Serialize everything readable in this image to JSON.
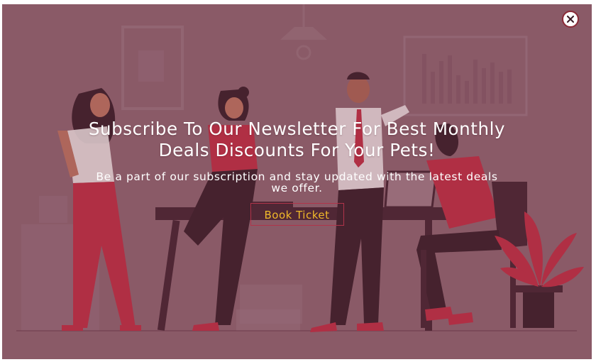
{
  "popup": {
    "headline": "Subscribe To Our Newsletter For Best Monthly Deals Discounts For Your Pets!",
    "subtext": "Be a part of our subscription and stay updated with the latest deals we offer.",
    "cta_label": "Book Ticket"
  },
  "icons": {
    "close": "close-icon"
  },
  "colors": {
    "overlay": "#8d5f6c",
    "accent_red": "#b82e44",
    "dark_figure": "#3f1f2b",
    "cta_text": "#f0b92a",
    "text": "#ffffff"
  }
}
